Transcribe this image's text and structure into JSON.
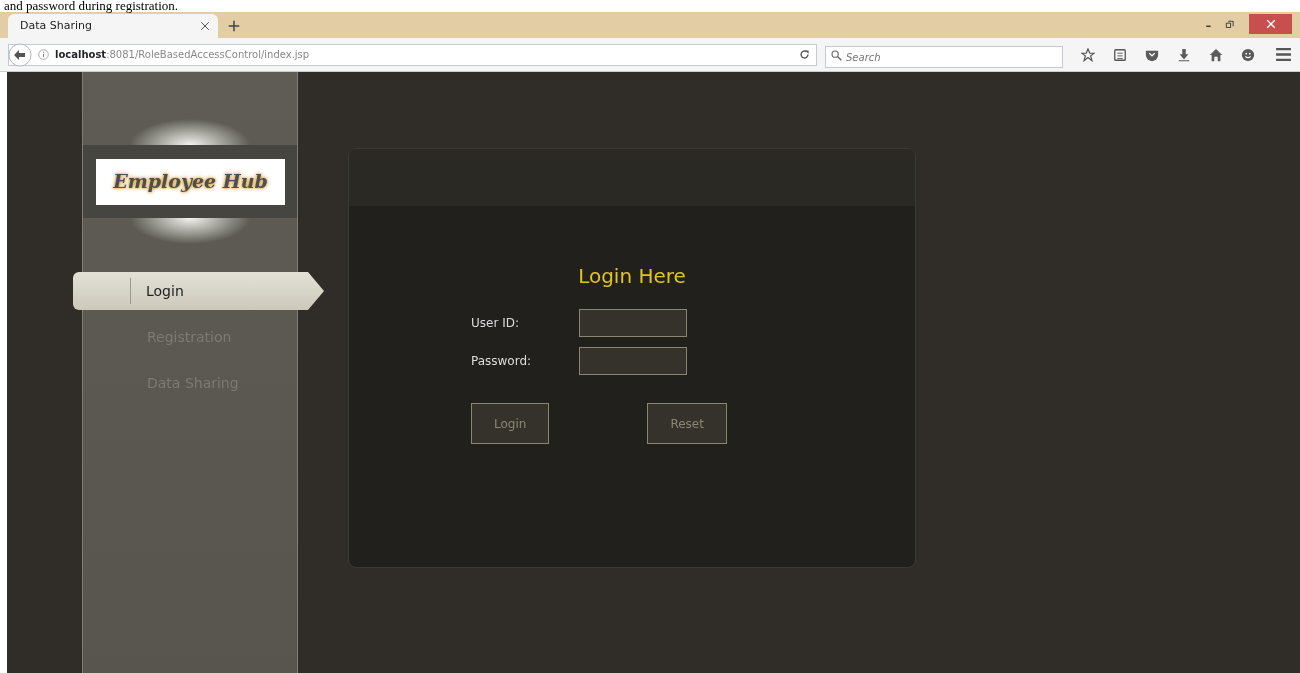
{
  "caption_fragment": "and password during registration.",
  "browser": {
    "tab": {
      "title": "Data Sharing",
      "selected": true
    },
    "url": {
      "host": "localhost",
      "rest": ":8081/RoleBasedAccessControl/index.jsp"
    },
    "search": {
      "placeholder": "Search"
    }
  },
  "logo": {
    "text": "Employee Hub"
  },
  "sidebar": {
    "items": [
      {
        "label": "Login",
        "selected": true
      },
      {
        "label": "Registration",
        "selected": false
      },
      {
        "label": "Data Sharing",
        "selected": false
      }
    ]
  },
  "login": {
    "title": "Login Here",
    "fields": [
      {
        "label": "User ID:"
      },
      {
        "label": "Password:"
      }
    ],
    "buttons": [
      "Login",
      "Reset"
    ]
  }
}
